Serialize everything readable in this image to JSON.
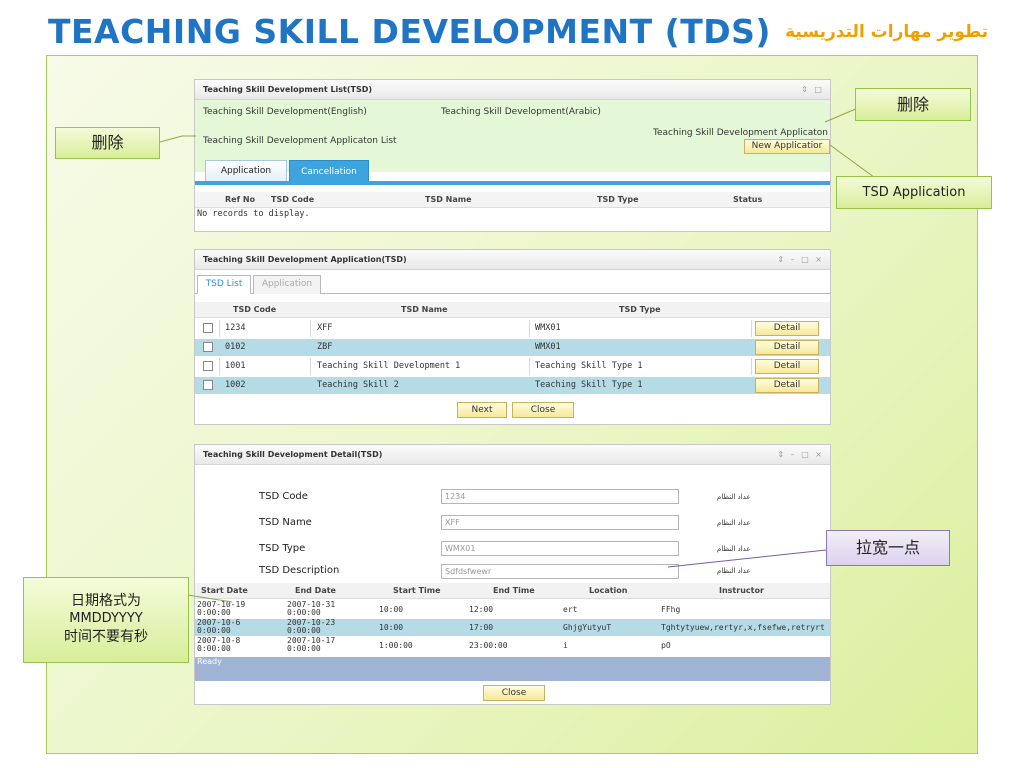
{
  "slide": {
    "title": "TEACHING SKILL DEVELOPMENT (TDS)",
    "arabic_title": "تطوير مهارات التدريسية"
  },
  "panel1": {
    "header": "Teaching Skill Development List(TSD)",
    "controls": "⇕ □",
    "link_english": "Teaching Skill Development(English)",
    "link_arabic": "Teaching Skill Development(Arabic)",
    "list_title": "Teaching Skill Development Applicaton List",
    "right_title": "Teaching Skill Development Applicaton",
    "new_button": "New Applicatior",
    "tabs": [
      "Application",
      "Cancellation"
    ],
    "columns": [
      "Ref No",
      "TSD Code",
      "TSD Name",
      "TSD Type",
      "Status"
    ],
    "empty_text": "No records to display."
  },
  "panel2": {
    "header": "Teaching Skill Development Application(TSD)",
    "controls": "⇕ – □ ×",
    "subtabs": [
      "TSD List",
      "Application"
    ],
    "columns": [
      "TSD Code",
      "TSD Name",
      "TSD Type"
    ],
    "rows": [
      {
        "code": "1234",
        "name": "XFF",
        "type": "WMX01",
        "action": "Detail"
      },
      {
        "code": "0102",
        "name": "ZBF",
        "type": "WMX01",
        "action": "Detail"
      },
      {
        "code": "1001",
        "name": "Teaching Skill Development 1",
        "type": "Teaching Skill Type 1",
        "action": "Detail"
      },
      {
        "code": "1002",
        "name": "Teaching Skill 2",
        "type": "Teaching Skill Type 1",
        "action": "Detail"
      }
    ],
    "next_button": "Next",
    "close_button": "Close"
  },
  "panel3": {
    "header": "Teaching Skill Development Detail(TSD)",
    "controls": "⇕ – □ ×",
    "fields": [
      {
        "label": "TSD Code",
        "value": "1234",
        "arabic": "عداد النظام"
      },
      {
        "label": "TSD Name",
        "value": "XFF",
        "arabic": "عداد النظام"
      },
      {
        "label": "TSD Type",
        "value": "WMX01",
        "arabic": "عداد النظام"
      },
      {
        "label": "TSD Description",
        "value": "Sdfdsfwewr",
        "arabic": "عداد النظام"
      }
    ],
    "columns": [
      "Start Date",
      "End Date",
      "Start Time",
      "End Time",
      "Location",
      "Instructor"
    ],
    "rows": [
      {
        "start_date": [
          "2007-10-19",
          "0:00:00"
        ],
        "end_date": [
          "2007-10-31",
          "0:00:00"
        ],
        "start_time": "10:00",
        "end_time": "12:00",
        "location": "ert",
        "instructor": "FFhg"
      },
      {
        "start_date": [
          "2007-10-6",
          "0:00:00"
        ],
        "end_date": [
          "2007-10-23",
          "0:00:00"
        ],
        "start_time": "10:00",
        "end_time": "17:00",
        "location": "GhjgYutyuT",
        "instructor": "Tghtytyuew,rertyr,x,fsefwe,retryrt"
      },
      {
        "start_date": [
          "2007-10-8",
          "0:00:00"
        ],
        "end_date": [
          "2007-10-17",
          "0:00:00"
        ],
        "start_time": "1:00:00",
        "end_time": "23:00:00",
        "location": "i",
        "instructor": "pO"
      }
    ],
    "status": "Ready",
    "close_button": "Close"
  },
  "callouts": {
    "delete_left": "删除",
    "delete_right": "删除",
    "tsd_application": "TSD Application",
    "widen": "拉宽一点",
    "date_format_line1": "日期格式为",
    "date_format_line2": "MMDDYYYY",
    "date_format_line3": "时间不要有秒"
  },
  "colors": {
    "title_blue": "#1f74c4",
    "arabic_orange": "#f0a000",
    "tab_blue": "#3ea4e0",
    "row_alt": "#b5dbe6",
    "callout_green": "#d8ee9a"
  }
}
